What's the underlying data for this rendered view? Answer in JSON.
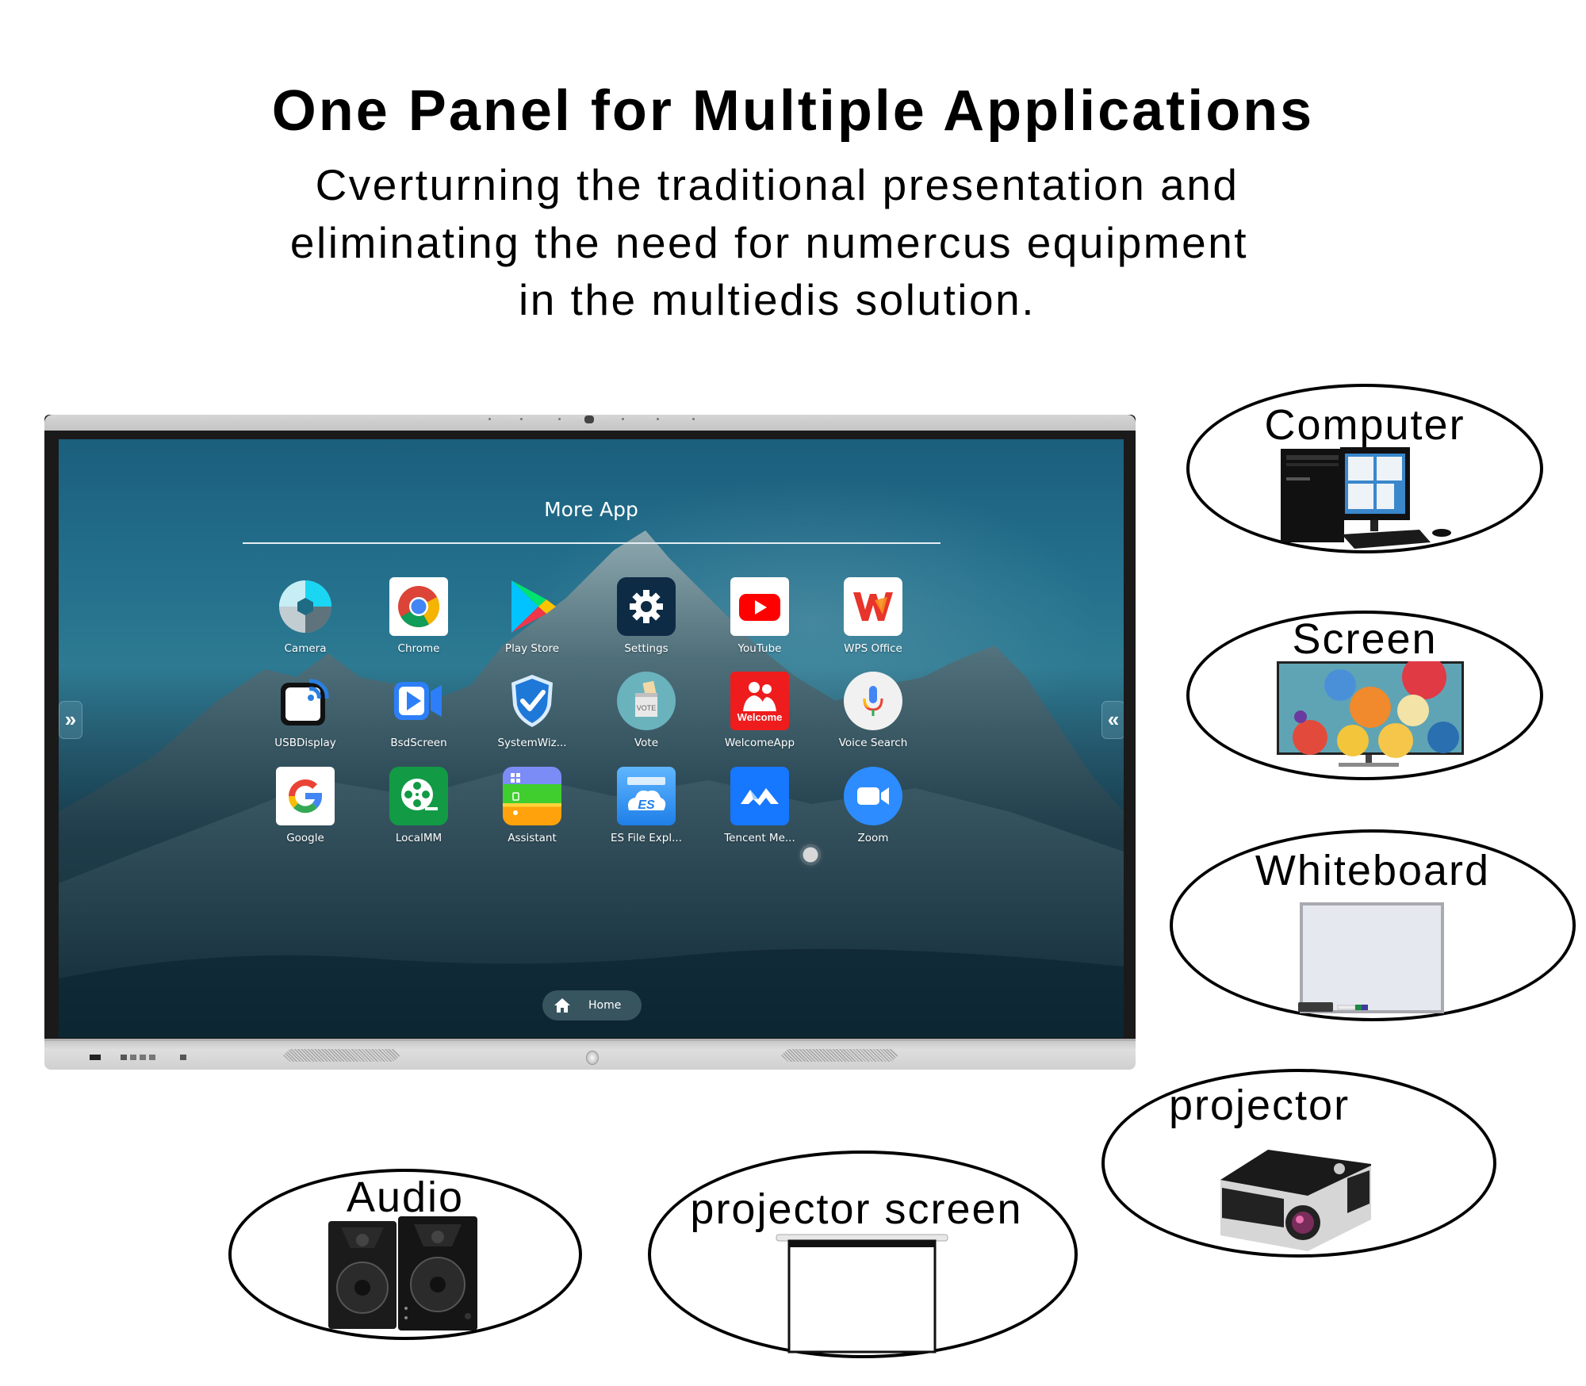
{
  "headline": "One Panel for Multiple Applications",
  "subtitle": {
    "line1": "Cverturning the traditional presentation and",
    "line2": "eliminating the need for numercus equipment",
    "line3": "in the multiedis solution."
  },
  "panel": {
    "section_title": "More App",
    "apps": [
      {
        "label": "Camera",
        "icon": "camera-icon"
      },
      {
        "label": "Chrome",
        "icon": "chrome-icon"
      },
      {
        "label": "Play Store",
        "icon": "play-store-icon"
      },
      {
        "label": "Settings",
        "icon": "gear-icon"
      },
      {
        "label": "YouTube",
        "icon": "youtube-icon"
      },
      {
        "label": "WPS Office",
        "icon": "wps-office-icon"
      },
      {
        "label": "USBDisplay",
        "icon": "usb-display-icon"
      },
      {
        "label": "BsdScreen",
        "icon": "video-camera-icon"
      },
      {
        "label": "SystemWiz...",
        "icon": "shield-check-icon"
      },
      {
        "label": "Vote",
        "icon": "ballot-box-icon"
      },
      {
        "label": "WelcomeApp",
        "icon": "welcome-people-icon",
        "badge": "Welcome"
      },
      {
        "label": "Voice Search",
        "icon": "microphone-icon"
      },
      {
        "label": "Google",
        "icon": "google-icon"
      },
      {
        "label": "LocalMM",
        "icon": "film-reel-icon"
      },
      {
        "label": "Assistant",
        "icon": "assistant-icon"
      },
      {
        "label": "ES File Expl...",
        "icon": "es-file-explorer-icon",
        "badge": "ES"
      },
      {
        "label": "Tencent Me...",
        "icon": "tencent-meeting-icon"
      },
      {
        "label": "Zoom",
        "icon": "zoom-video-icon"
      }
    ],
    "vote_badge": "VOTE",
    "home_button": "Home",
    "left_arrow": "»",
    "right_arrow": "«"
  },
  "devices": [
    {
      "label": "Computer"
    },
    {
      "label": "Screen"
    },
    {
      "label": "Whiteboard"
    },
    {
      "label": "projector"
    },
    {
      "label": "projector screen"
    },
    {
      "label": "Audio"
    }
  ],
  "colors": {
    "youtube": "#ff0000",
    "wps": "#e8342a",
    "settings_bg": "#0d2b45",
    "welcome_red": "#ee1c1c",
    "zoom_blue": "#2d8cff",
    "localmm_green": "#129a45"
  }
}
